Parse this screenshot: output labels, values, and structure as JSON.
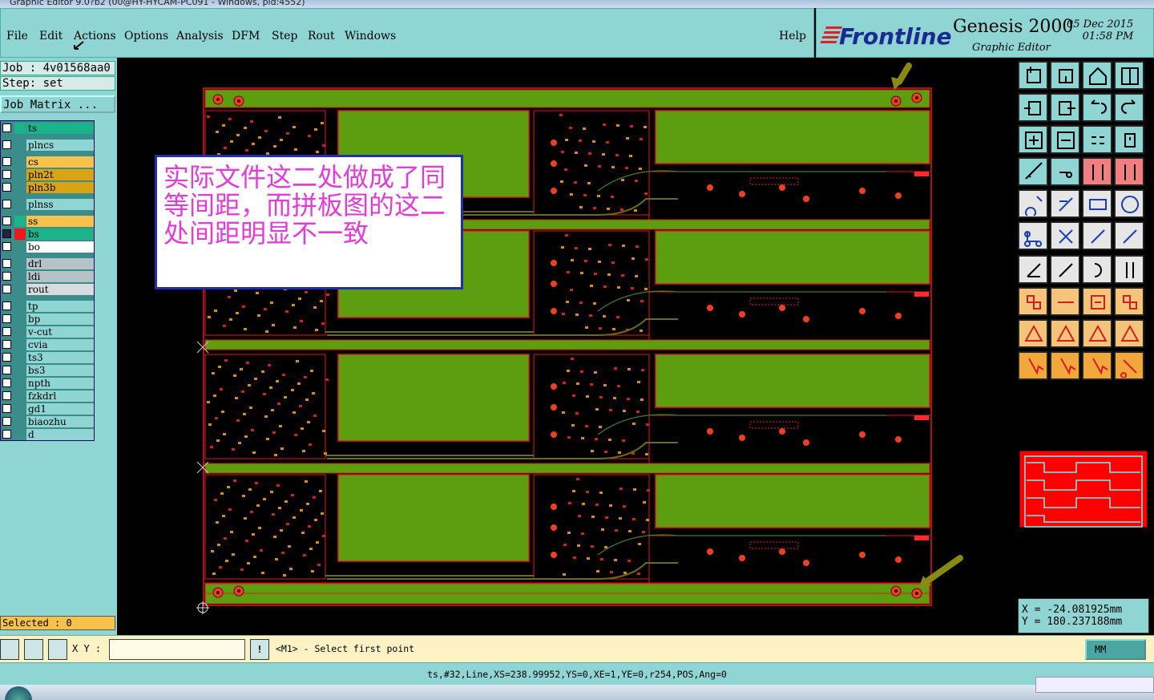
{
  "window": {
    "title": "Graphic Editor 9.0?b2 (00@HY-HYCAM-PC091 - Windows, pid:4552)"
  },
  "menu": {
    "items": [
      "File",
      "Edit",
      "Actions",
      "Options",
      "Analysis",
      "DFM",
      "Step",
      "Rout",
      "Windows"
    ],
    "help": "Help"
  },
  "brand": {
    "logo": "Frontline",
    "product": "Genesis 2000",
    "subtitle": "Graphic Editor",
    "date": "05 Dec 2015",
    "time": "01:58 PM"
  },
  "job": {
    "job_line": "Job : 4v01568aa0",
    "step_line": "Step: set",
    "matrix_button": "Job Matrix ..."
  },
  "layers": [
    {
      "name": "ts",
      "color": "#1ab38a",
      "row": "#1ab38a"
    },
    {
      "name": "plncs",
      "color": "",
      "row": "#8fd5d4"
    },
    {
      "name": "cs",
      "color": "",
      "row": "#f7c24a"
    },
    {
      "name": "pln2t",
      "color": "",
      "row": "#d8a414"
    },
    {
      "name": "pln3b",
      "color": "",
      "row": "#d8a414"
    },
    {
      "name": "plnss",
      "color": "",
      "row": "#8fd5d4"
    },
    {
      "name": "ss",
      "color": "#1ab38a",
      "row": "#f7c24a"
    },
    {
      "name": "bs",
      "color": "#f01818",
      "row": "#1ab38a"
    },
    {
      "name": "bo",
      "color": "",
      "row": "#ffffff"
    },
    {
      "name": "drl",
      "color": "",
      "row": "#b5c3c8"
    },
    {
      "name": "ldi",
      "color": "",
      "row": "#b5c3c8"
    },
    {
      "name": "rout",
      "color": "",
      "row": "#d8dcdc"
    },
    {
      "name": "tp",
      "color": "",
      "row": "#8fd5d4"
    },
    {
      "name": "bp",
      "color": "",
      "row": "#8fd5d4"
    },
    {
      "name": "v-cut",
      "color": "",
      "row": "#8fd5d4"
    },
    {
      "name": "cvia",
      "color": "",
      "row": "#8fd5d4"
    },
    {
      "name": "ts3",
      "color": "",
      "row": "#8fd5d4"
    },
    {
      "name": "bs3",
      "color": "",
      "row": "#8fd5d4"
    },
    {
      "name": "npth",
      "color": "",
      "row": "#8fd5d4"
    },
    {
      "name": "fzkdrl",
      "color": "",
      "row": "#8fd5d4"
    },
    {
      "name": "gd1",
      "color": "",
      "row": "#8fd5d4"
    },
    {
      "name": "biaozhu",
      "color": "",
      "row": "#8fd5d4"
    },
    {
      "name": "d",
      "color": "",
      "row": "#8fd5d4"
    }
  ],
  "selected": "Selected : 0",
  "annotation": {
    "text": "实际文件这二处做成了同等间距，而拼板图的这二处间距明显不一致"
  },
  "coords": {
    "x": "X = -24.081925mm",
    "y": "Y = 180.237188mm"
  },
  "input": {
    "label": "X Y :",
    "value": "",
    "prompt": "<M1> - Select first point",
    "units": "MM"
  },
  "status": "ts,#32,Line,XS=238.99952,YS=0,XE=1,YE=0,r254,POS,Ang=0",
  "colors": {
    "panel": "#8fd5d4",
    "board": "#5c9e10",
    "outline": "#e01818",
    "pad": "#f04020"
  }
}
